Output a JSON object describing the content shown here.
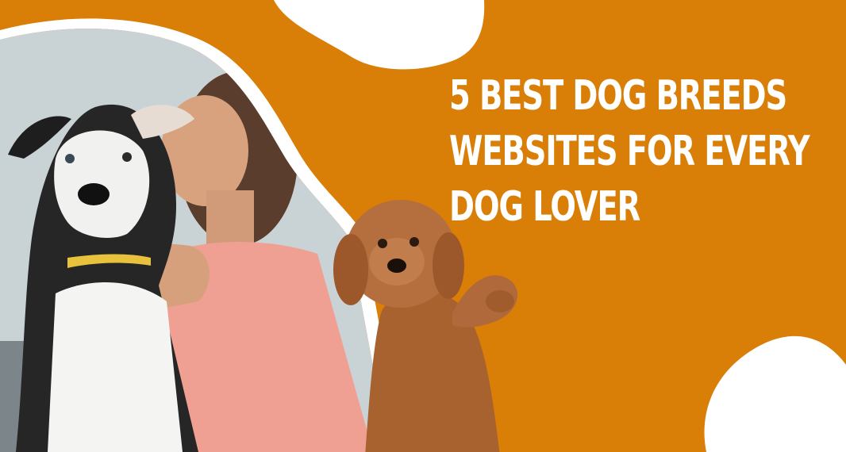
{
  "banner": {
    "headline_lines": [
      "5 BEST DOG BREEDS",
      "WEBSITES FOR EVERY",
      "DOG LOVER"
    ]
  },
  "colors": {
    "background": "#d97e06",
    "accent_white": "#ffffff",
    "photo_wall": "#c9d3d6",
    "shirt": "#f0a093",
    "puppy_fur": "#b06a3a"
  },
  "images": {
    "main_photo": "woman-hugging-black-white-dog-photo",
    "puppy_photo": "brown-curly-puppy-photo"
  }
}
